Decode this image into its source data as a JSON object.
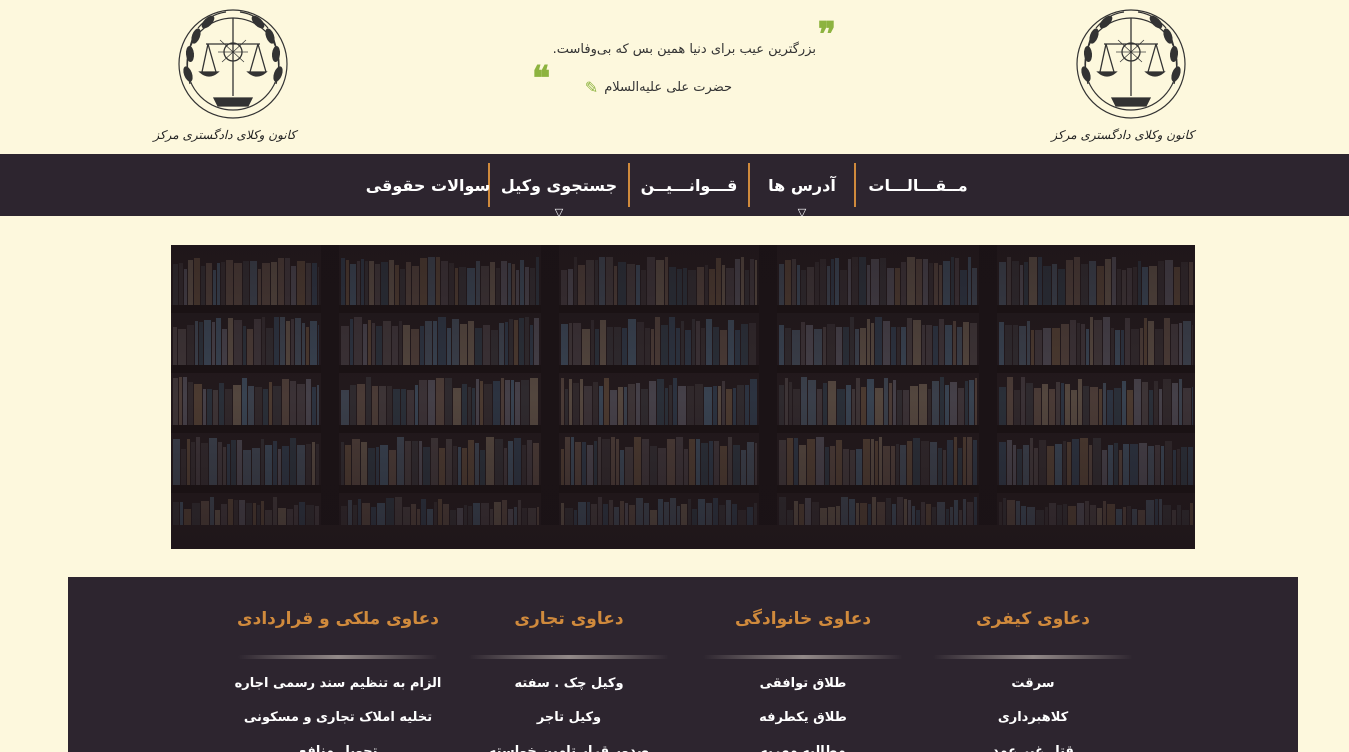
{
  "header": {
    "emblem_caption": "کانون وکلای دادگستری مرکز",
    "quote": {
      "text": "بزرگترین عیب برای دنیا همین بس که بی‌وفاست.",
      "author": "حضرت علی علیه‌السلام",
      "open_mark": "❞",
      "close_mark": "❝"
    }
  },
  "nav": {
    "items": [
      {
        "label": "مــقـــالـــات",
        "caret": ""
      },
      {
        "label": "آدرس ها",
        "caret": "▽"
      },
      {
        "label": "قـــوانـــیــن",
        "caret": ""
      },
      {
        "label": "جستجوی وکیل",
        "caret": "▽"
      },
      {
        "label": "سوالات حقوقی",
        "caret": ""
      }
    ]
  },
  "categories": [
    {
      "title": "دعاوی کیفری",
      "items": [
        "سرقت",
        "کلاهبرداری",
        "قتل غیر عمد"
      ]
    },
    {
      "title": "دعاوی خانوادگی",
      "items": [
        "طلاق توافقی",
        "طلاق یکطرفه",
        "مطالبه مهریه"
      ]
    },
    {
      "title": "دعاوی تجاری",
      "items": [
        "وکیل چک . سفته",
        "وکیل تاجر",
        "صدور قرار تامین خواسته"
      ]
    },
    {
      "title": "دعاوی ملکی و قراردادی",
      "items": [
        "الزام به تنظیم سند رسمی اجاره",
        "تخلیه املاک تجاری و مسکونی",
        "تحویل منافع"
      ]
    }
  ],
  "colors": {
    "background": "#fdf8dd",
    "dark": "#2d252f",
    "accent_orange": "#d08a3c",
    "accent_green": "#8db33f"
  },
  "icons": {
    "quote_open": "double-quote-icon",
    "quote_close": "double-quote-icon",
    "author": "pen-icon",
    "emblem": "scales-of-justice-emblem"
  }
}
